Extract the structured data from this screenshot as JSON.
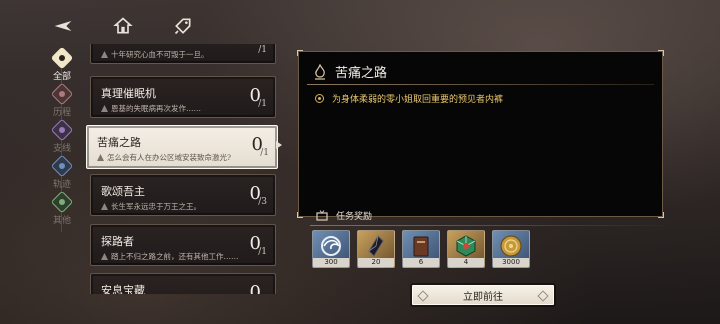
{
  "nav": {
    "back_icon": "back-arrow-icon",
    "home_icon": "home-icon",
    "map_icon": "tag-icon"
  },
  "categories": [
    {
      "label": "全部",
      "icon": "all-diamond-icon",
      "color": "#f2e6c8",
      "active": true
    },
    {
      "label": "历程",
      "icon": "journey-diamond-icon",
      "color": "#b07a7a",
      "active": false
    },
    {
      "label": "支线",
      "icon": "side-diamond-icon",
      "color": "#9a7ab8",
      "active": false
    },
    {
      "label": "轨迹",
      "icon": "trace-diamond-icon",
      "color": "#6f8fc0",
      "active": false
    },
    {
      "label": "其他",
      "icon": "other-diamond-icon",
      "color": "#7fae7a",
      "active": false
    }
  ],
  "quests": [
    {
      "title": "",
      "subtitle": "十年研究心血不可毁于一旦。",
      "progress": "0",
      "total": "/1"
    },
    {
      "title": "真理催眠机",
      "subtitle": "恩基的失眠病再次发作……",
      "progress": "0",
      "total": "/1"
    },
    {
      "title": "苦痛之路",
      "subtitle": "怎么会有人在办公区域安装致命激光?",
      "progress": "0",
      "total": "/1"
    },
    {
      "title": "歌颂吾主",
      "subtitle": "长生军永远忠于万王之王。",
      "progress": "0",
      "total": "/3"
    },
    {
      "title": "探路者",
      "subtitle": "踏上不归之路之前，还有其他工作……",
      "progress": "0",
      "total": "/1"
    },
    {
      "title": "安息宝藏",
      "subtitle": "",
      "progress": "0",
      "total": ""
    }
  ],
  "detail": {
    "title": "苦痛之路",
    "objective": "为身体柔弱的零小姐取回重要的预见者内裤"
  },
  "rewards": {
    "label": "任务奖励",
    "items": [
      {
        "name": "swirl-badge",
        "qty": "300"
      },
      {
        "name": "dark-crystal",
        "qty": "20"
      },
      {
        "name": "leather-book",
        "qty": "6"
      },
      {
        "name": "emerald-cube",
        "qty": "4"
      },
      {
        "name": "gold-coin",
        "qty": "3000"
      }
    ]
  },
  "action": {
    "label": "立即前往"
  }
}
